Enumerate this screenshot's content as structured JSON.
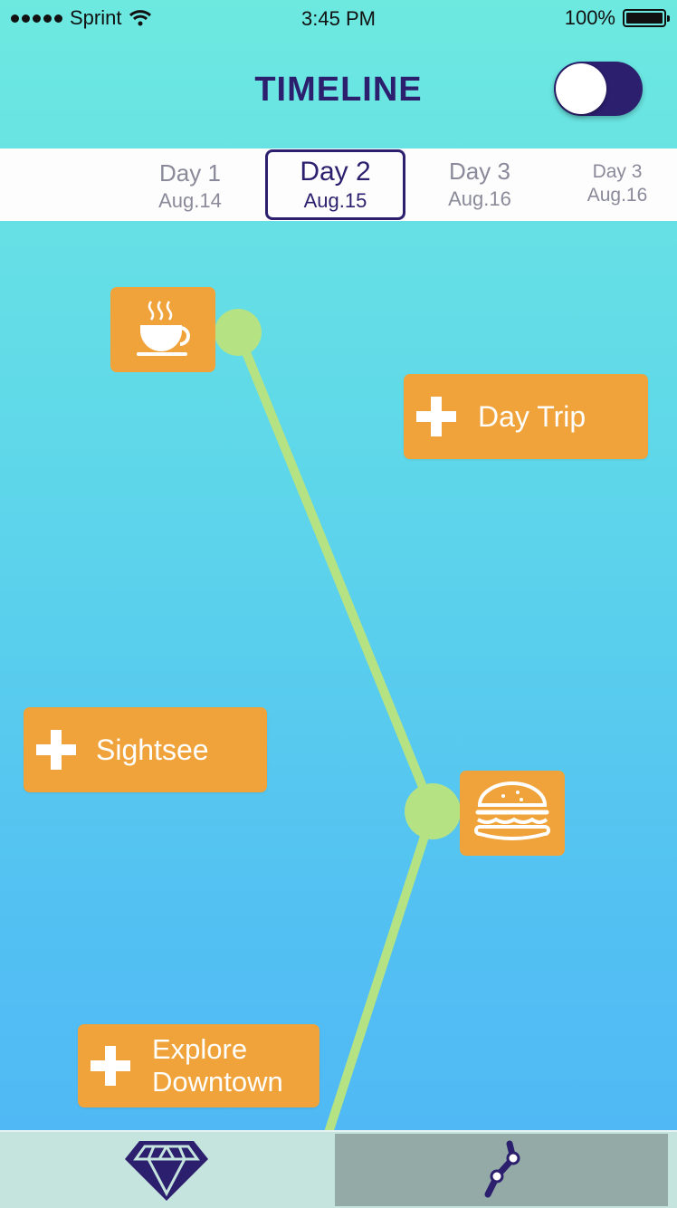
{
  "status_bar": {
    "carrier": "Sprint",
    "time": "3:45 PM",
    "battery": "100%"
  },
  "header": {
    "title": "TIMELINE",
    "toggle_on": false
  },
  "days": [
    {
      "day": "Day 1",
      "date": "Aug.14"
    },
    {
      "day": "Day 2",
      "date": "Aug.15"
    },
    {
      "day": "Day 3",
      "date": "Aug.16"
    },
    {
      "day": "Day 3",
      "date": "Aug.16"
    }
  ],
  "selected_day_index": 1,
  "timeline": {
    "stops": [
      {
        "icon": "coffee-cup-icon"
      },
      {
        "icon": "burger-icon"
      }
    ],
    "suggestions": [
      {
        "label": "Day Trip",
        "icon": "plus-icon"
      },
      {
        "label": "Sightsee",
        "icon": "plus-icon"
      },
      {
        "label_line1": "Explore",
        "label_line2": "Downtown",
        "icon": "plus-icon"
      }
    ]
  },
  "tab_bar": {
    "tabs": [
      {
        "icon": "diamond-icon",
        "active": false
      },
      {
        "icon": "route-icon",
        "active": true
      }
    ]
  },
  "colors": {
    "accent": "#2b1f6e",
    "card": "#f0a33a",
    "line": "#b5e384"
  }
}
